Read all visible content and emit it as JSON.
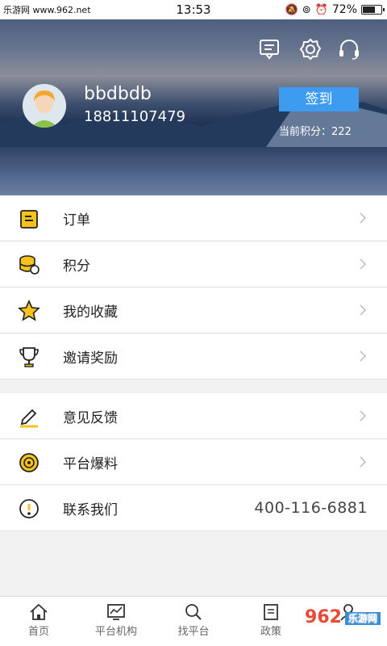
{
  "status": {
    "watermark_site": "乐游网 www.962.net",
    "time": "13:53",
    "battery": "72%",
    "battery_level": 0.72
  },
  "header": {
    "username": "bbdbdb",
    "phone": "18811107479",
    "signin_label": "签到",
    "points_text": "当前积分：222",
    "icons": [
      "message-icon",
      "settings-icon",
      "headset-icon"
    ]
  },
  "menu_group1": [
    {
      "label": "订单",
      "icon": "order-icon"
    },
    {
      "label": "积分",
      "icon": "coins-icon"
    },
    {
      "label": "我的收藏",
      "icon": "star-icon"
    },
    {
      "label": "邀请奖励",
      "icon": "trophy-icon"
    }
  ],
  "menu_group2": [
    {
      "label": "意见反馈",
      "icon": "edit-icon"
    },
    {
      "label": "平台爆料",
      "icon": "disc-icon"
    },
    {
      "label": "联系我们",
      "icon": "alert-icon",
      "value": "400-116-6881"
    }
  ],
  "tabs": [
    {
      "label": "首页",
      "icon": "home-icon"
    },
    {
      "label": "平台机构",
      "icon": "chart-icon"
    },
    {
      "label": "找平台",
      "icon": "search-icon"
    },
    {
      "label": "政策",
      "icon": "document-icon"
    },
    {
      "label": "",
      "icon": "user-icon"
    }
  ],
  "watermark_logo": {
    "brand": "962",
    "sub": "乐游网"
  },
  "colors": {
    "accent_blue": "#3e9cf0",
    "icon_yellow": "#f6c21c"
  }
}
